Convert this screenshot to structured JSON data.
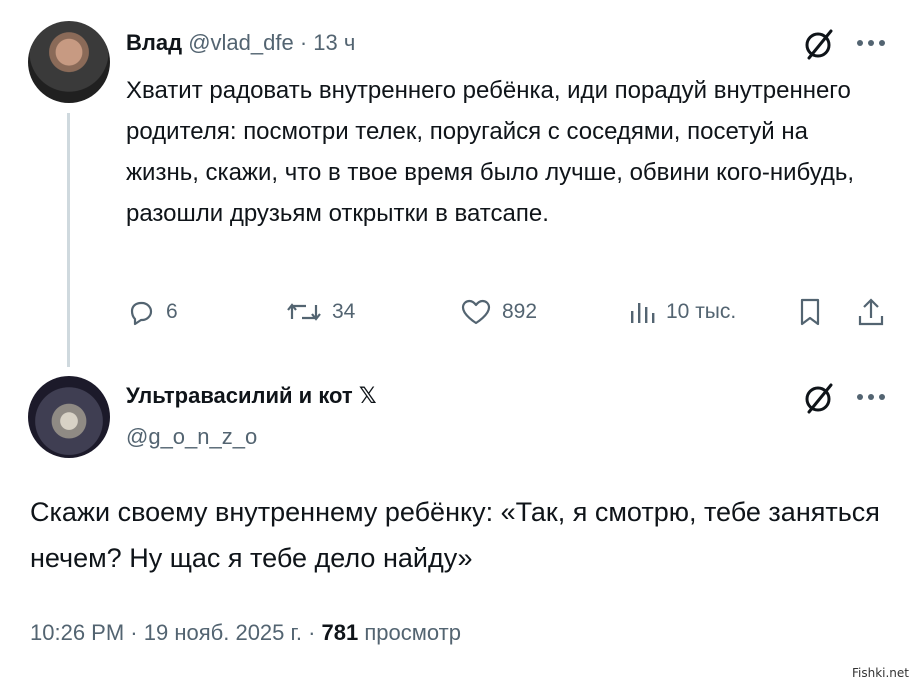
{
  "tweet1": {
    "name": "Влад",
    "handle": "@vlad_dfe",
    "separator": "·",
    "time": "13 ч",
    "text": "Хватит радовать внутреннего ребёнка, иди порадуй внутреннего родителя: посмотри телек, поругайся с соседями, посетуй на жизнь, скажи, что в твое время было лучше, обвини кого-нибудь, разошли друзьям открытки в ватсапе.",
    "replies": "6",
    "reposts": "34",
    "likes": "892",
    "views": "10 тыс."
  },
  "tweet2": {
    "name": "Ультравасилий и кот",
    "name_badge": "𝕏",
    "handle": "@g_o_n_z_o",
    "text": "Скажи своему внутреннему ребёнку: «Так, я смотрю, тебе заняться нечем? Ну щас я тебе дело найду»",
    "time": "10:26 PM",
    "sep1": "·",
    "date": "19 нояб. 2025 г.",
    "sep2": "·",
    "views_count": "781",
    "views_label": "просмотр"
  },
  "watermark": "Fishki.net",
  "colors": {
    "text": "#0f1419",
    "muted": "#536471",
    "thread_line": "#cfd9de"
  }
}
